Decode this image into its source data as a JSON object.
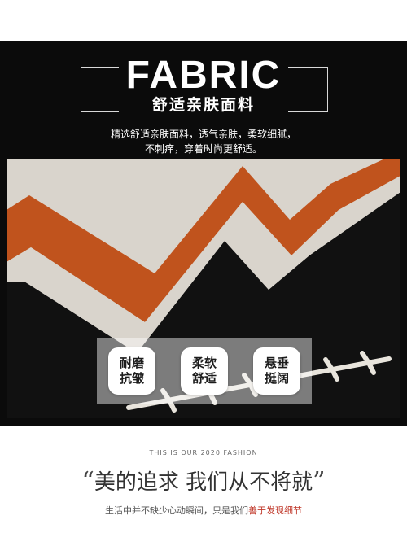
{
  "header": {
    "title": "FABRIC",
    "subtitle": "舒适亲肤面料",
    "description_line1": "精选舒适亲肤面料，透气亲肤，柔软细腻，",
    "description_line2": "不刺痒，穿着时尚更舒适。"
  },
  "features": [
    {
      "line1": "耐磨",
      "line2": "抗皱"
    },
    {
      "line1": "柔软",
      "line2": "舒适"
    },
    {
      "line1": "悬垂",
      "line2": "挺阔"
    }
  ],
  "slogan": {
    "english": "THIS IS OUR 2020 FASHION",
    "open_quote": "“",
    "chinese": "美的追求 我们从不将就",
    "close_quote": "”",
    "tagline_plain": "生活中并不缺少心动瞬间，只是我们",
    "tagline_accent": "善于发现细节"
  },
  "colors": {
    "background": "#0b0b0b",
    "fabric_cream": "#d9d4cc",
    "fabric_orange": "#c0531d",
    "accent_red": "#c0392b"
  }
}
